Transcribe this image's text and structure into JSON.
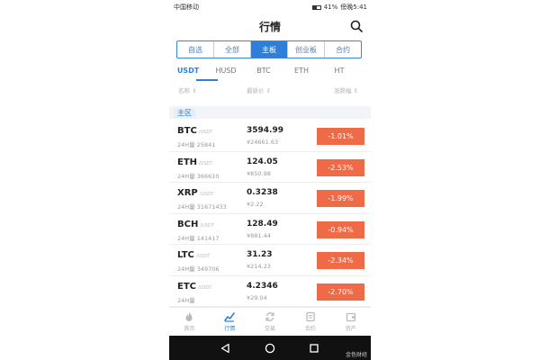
{
  "status_bar": {
    "carrier": "中国移动",
    "battery": "41%",
    "time": "傍晚5:41"
  },
  "header": {
    "title": "行情"
  },
  "segment_tabs": [
    {
      "label": "自选",
      "active": false
    },
    {
      "label": "全部",
      "active": false
    },
    {
      "label": "主板",
      "active": true
    },
    {
      "label": "创业板",
      "active": false
    },
    {
      "label": "合约",
      "active": false
    }
  ],
  "coin_tabs": [
    {
      "label": "USDT",
      "active": true
    },
    {
      "label": "HUSD",
      "active": false
    },
    {
      "label": "BTC",
      "active": false
    },
    {
      "label": "ETH",
      "active": false
    },
    {
      "label": "HT",
      "active": false
    }
  ],
  "columns": {
    "name": "名称 ⇕",
    "price": "最新价 ⇕",
    "change": "涨跌幅 ⇕"
  },
  "section_label": "主区",
  "quote_unit": "/USDT",
  "rows": [
    {
      "symbol": "BTC",
      "volume": "24H量 25841",
      "price": "3594.99",
      "cny": "¥24661.63",
      "change": "-1.01%"
    },
    {
      "symbol": "ETH",
      "volume": "24H量 366610",
      "price": "124.05",
      "cny": "¥850.98",
      "change": "-2.53%"
    },
    {
      "symbol": "XRP",
      "volume": "24H量 31671433",
      "price": "0.3238",
      "cny": "¥2.22",
      "change": "-1.99%"
    },
    {
      "symbol": "BCH",
      "volume": "24H量 141417",
      "price": "128.49",
      "cny": "¥881.44",
      "change": "-0.94%"
    },
    {
      "symbol": "LTC",
      "volume": "24H量 349706",
      "price": "31.23",
      "cny": "¥214.23",
      "change": "-2.34%"
    },
    {
      "symbol": "ETC",
      "volume": "24H量 ",
      "price": "4.2346",
      "cny": "¥29.04",
      "change": "-2.70%"
    }
  ],
  "bottom_nav": [
    {
      "label": "首页",
      "icon": "fire-icon",
      "active": false
    },
    {
      "label": "行情",
      "icon": "chart-icon",
      "active": true
    },
    {
      "label": "交易",
      "icon": "exchange-icon",
      "active": false
    },
    {
      "label": "合约",
      "icon": "contract-icon",
      "active": false
    },
    {
      "label": "资产",
      "icon": "wallet-icon",
      "active": false
    }
  ],
  "watermark": "金色财经",
  "colors": {
    "accent": "#2f7fd8",
    "down": "#ef6a47",
    "nav_bar": "#111111"
  }
}
